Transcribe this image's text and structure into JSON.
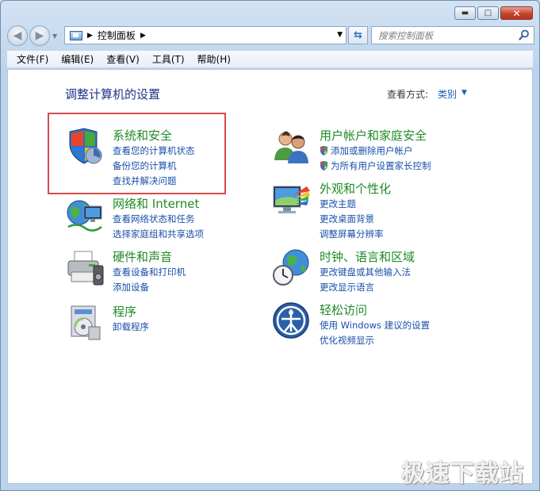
{
  "nav": {
    "address_label": "控制面板",
    "search_placeholder": "搜索控制面板"
  },
  "menubar": {
    "items": [
      "文件(F)",
      "编辑(E)",
      "查看(V)",
      "工具(T)",
      "帮助(H)"
    ]
  },
  "main": {
    "title": "调整计算机的设置",
    "view_label": "查看方式:",
    "view_value": "类别"
  },
  "categories": [
    {
      "title": "系统和安全",
      "links": [
        "查看您的计算机状态",
        "备份您的计算机",
        "查找并解决问题"
      ]
    },
    {
      "title": "网络和 Internet",
      "links": [
        "查看网络状态和任务",
        "选择家庭组和共享选项"
      ]
    },
    {
      "title": "硬件和声音",
      "links": [
        "查看设备和打印机",
        "添加设备"
      ]
    },
    {
      "title": "程序",
      "links": [
        "卸载程序"
      ]
    },
    {
      "title": "用户帐户和家庭安全",
      "links": [
        "添加或删除用户帐户",
        "为所有用户设置家长控制"
      ]
    },
    {
      "title": "外观和个性化",
      "links": [
        "更改主题",
        "更改桌面背景",
        "调整屏幕分辨率"
      ]
    },
    {
      "title": "时钟、语言和区域",
      "links": [
        "更改键盘或其他输入法",
        "更改显示语言"
      ]
    },
    {
      "title": "轻松访问",
      "links": [
        "使用 Windows 建议的设置",
        "优化视频显示"
      ]
    }
  ],
  "watermark": "极速下载站",
  "colors": {
    "category_title": "#1e8a26",
    "link": "#1a4fa8",
    "title": "#1e3287",
    "highlight": "#d94a4a"
  }
}
